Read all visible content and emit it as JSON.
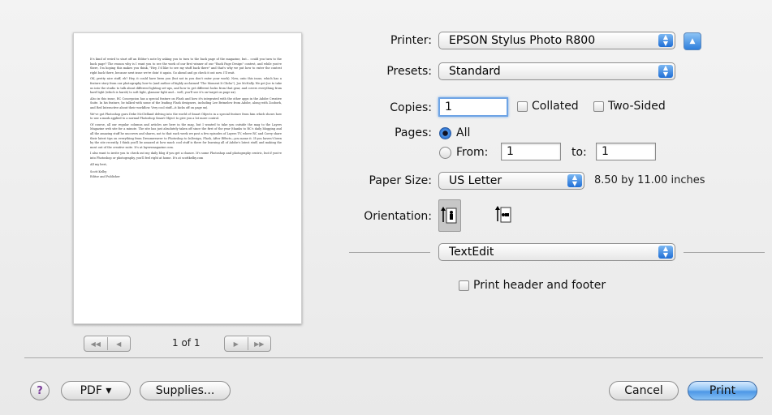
{
  "preview": {
    "paragraphs": [
      "It's kind of weird to start off an Editor's note by asking you to turn to the back page of the magazine, but... could you turn to the back page? The reason why is I want you to see the work of our first winner of our \"Back Page Design\" contest, and while you're there, I'm hoping this makes you think, \"Hey, I'd like to see my stuff back there\" and that's why we put how to enter the contest right back there, because next issue we're doin' it again. Go ahead and go check it out now. I'll wait.",
      "OK, pretty nice stuff, eh? Hey, it could have been you (but not in you don't enter your work). Now, onto this issue, which has a feature story from our photography how-to (and author of highly acclaimed \"The Moment It Clicks\"), Joe McNally. We get Joe to take us into the studio to talk about different lighting set-ups, and how to get different looks from that gear, and covers everything from hard light (which is harsh) to soft light, glamour light and... well, you'll see it's on-target on page xx).",
      "Also in this issue, RC Concepcion has a special feature on Flash and how it's integrated with the other apps in the Adobe Creative Suite. In his feature, he talked with some of the leading Flash designers, including Lee Brimelow from Adobe, along with Zoobork, and Red Interactive about their workflow. Very cool stuff—it kicks off on page xx).",
      "We've got Photoshop guru Deke McClelland delving into the world of Smart Objects in a special feature from him which shows how to use a mask applied to a normal Photoshop Smart Object to give you a lot more control.",
      "Of course, all our regular columns and articles are here in the mag, but I wanted to take you outside the mag to the Layers Magazine web site for a minute. The site has just absolutely taken off since the first of the year (thanks to RC's daily blogging and all the amazing stuff he uncovers and shares, not to that each week we post a few episodes of Layers TV, where RC and Corey share their latest tips on everything from Dreamweaver to Photoshop to InDesign, Flash, After Effects—you name it. If you haven't been by the site recently, I think you'll be amazed at how much cool stuff is there for learning all of Adobe's latest stuff, and making the most out of the creative suite. It's at layersmagazine.com.",
      "I also want to invite you to check out my daily blog if you get a chance. It's some Photoshop and photography centric, but if you're into Photoshop or photography, you'll feel right at home. It's at scottkelby.com",
      "All my best,",
      "Scott Kelby\nEditor and Publisher"
    ]
  },
  "nav": {
    "first": "◀◀",
    "prev": "◀",
    "counter": "1 of 1",
    "next": "▶",
    "last": "▶▶"
  },
  "printer": {
    "label": "Printer:",
    "value": "EPSON Stylus Photo R800"
  },
  "presets": {
    "label": "Presets:",
    "value": "Standard"
  },
  "copies": {
    "label": "Copies:",
    "value": "1",
    "collated": "Collated",
    "two_sided": "Two-Sided"
  },
  "pages": {
    "label": "Pages:",
    "all": "All",
    "from": "From:",
    "from_value": "1",
    "to": "to:",
    "to_value": "1"
  },
  "paper": {
    "label": "Paper Size:",
    "value": "US Letter",
    "dims": "8.50 by 11.00 inches"
  },
  "orientation": {
    "label": "Orientation:"
  },
  "panel": {
    "value": "TextEdit"
  },
  "header_footer": {
    "label": "Print header and footer"
  },
  "buttons": {
    "help": "?",
    "pdf": "PDF ▾",
    "supplies": "Supplies...",
    "cancel": "Cancel",
    "print": "Print"
  },
  "colors": {
    "accent": "#2f7fdc",
    "background": "#ececec"
  }
}
